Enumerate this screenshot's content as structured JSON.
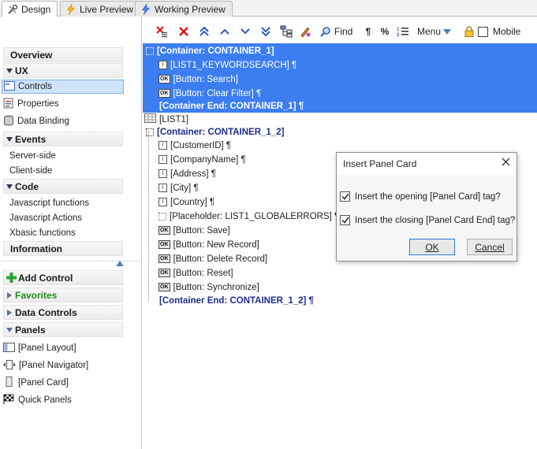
{
  "tabs": [
    {
      "label": "Design",
      "icon": "tools-icon",
      "active": true
    },
    {
      "label": "Live Preview",
      "icon": "lightning-icon",
      "active": false
    },
    {
      "label": "Working Preview",
      "icon": "lightning-blue-icon",
      "active": false
    }
  ],
  "toolbar": {
    "find_label": "Find",
    "menu_label": "Menu",
    "mobile_label": "Mobile",
    "pilcrow": "¶",
    "percent": "%"
  },
  "left": {
    "overview": "Overview",
    "ux": "UX",
    "controls": "Controls",
    "properties": "Properties",
    "data_binding": "Data Binding",
    "events": "Events",
    "server_side": "Server-side",
    "client_side": "Client-side",
    "code": "Code",
    "js_functions": "Javascript functions",
    "js_actions": "Javascript Actions",
    "xbasic": "Xbasic functions",
    "information": "Information",
    "add_control": "Add Control",
    "favorites": "Favorites",
    "data_controls": "Data Controls",
    "panels": "Panels",
    "panel_layout": "[Panel Layout]",
    "panel_navigator": "[Panel Navigator]",
    "panel_card": "[Panel Card]",
    "quick_panels": "Quick Panels"
  },
  "editor": {
    "rows": [
      "[Container: CONTAINER_1]",
      "[LIST1_KEYWORDSEARCH] ¶",
      "[Button: Search]",
      "[Button: Clear Filter] ¶",
      "[Container End: CONTAINER_1] ¶",
      "[LIST1]",
      "[Container: CONTAINER_1_2]",
      "[CustomerID] ¶",
      "[CompanyName] ¶",
      "[Address] ¶",
      "[City] ¶",
      "[Country] ¶",
      "[Placeholder: LIST1_GLOBALERRORS] ¶",
      "[Button: Save]",
      "[Button: New Record]",
      "[Button: Delete Record]",
      "[Button: Reset]",
      "[Button: Synchronize]",
      "[Container End: CONTAINER_1_2] ¶"
    ]
  },
  "dialog": {
    "title": "Insert Panel Card",
    "opt1": "Insert the opening [Panel Card] tag?",
    "opt2": "Insert the closing [Panel Card End] tag?",
    "ok": "OK",
    "cancel": "Cancel"
  },
  "colors": {
    "selection": "#3c7ef0",
    "container_text": "#1d2e8c",
    "favorites": "#1e8a1e",
    "selected_item_bg": "#cfe3fb"
  }
}
